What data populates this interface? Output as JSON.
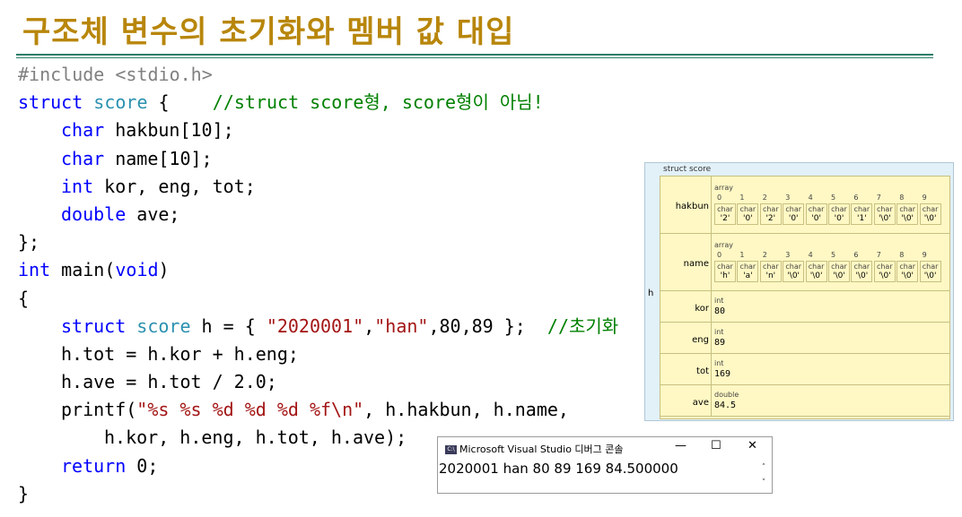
{
  "title": "구조체 변수의 초기화와 멤버 값 대입",
  "code": {
    "include": "#include <stdio.h>",
    "l2_struct": "struct",
    "l2_score": "score",
    "l2_brace": " {",
    "l2_comment": "//struct score형, score형이 아님!",
    "l3_type": "char",
    "l3_rest": " hakbun[10];",
    "l4_type": "char",
    "l4_rest": " name[10];",
    "l5_type": "int",
    "l5_rest": " kor, eng, tot;",
    "l6_type": "double",
    "l6_rest": " ave;",
    "l7": "};",
    "l8_int": "int",
    "l8_main": " main(",
    "l8_void": "void",
    "l8_close": ")",
    "l9": "{",
    "l10_struct": "struct",
    "l10_score": "score",
    "l10_mid": " h = { ",
    "l10_str1": "\"2020001\"",
    "l10_comma": ",",
    "l10_str2": "\"han\"",
    "l10_tail": ",80,89 };",
    "l10_comment": "//초기화",
    "l11": "h.tot = h.kor + h.eng;",
    "l12": "h.ave = h.tot / 2.0;",
    "l13_fn": "printf(",
    "l13_fmt": "\"%s %s %d %d %d %f\\n\"",
    "l13_rest": ", h.hakbun, h.name,",
    "l14": "h.kor, h.eng, h.tot, h.ave);",
    "l15_kw": "return",
    "l15_rest": " 0;",
    "l16": "}"
  },
  "debug_panel": {
    "label": "struct score",
    "var_name": "h",
    "fields": [
      {
        "name": "hakbun",
        "kind": "array",
        "elem_type": "char",
        "indices": [
          "0",
          "1",
          "2",
          "3",
          "4",
          "5",
          "6",
          "7",
          "8",
          "9"
        ],
        "values": [
          "'2'",
          "'0'",
          "'2'",
          "'0'",
          "'0'",
          "'0'",
          "'1'",
          "'\\0'",
          "'\\0'",
          "'\\0'"
        ]
      },
      {
        "name": "name",
        "kind": "array",
        "elem_type": "char",
        "indices": [
          "0",
          "1",
          "2",
          "3",
          "4",
          "5",
          "6",
          "7",
          "8",
          "9"
        ],
        "values": [
          "'h'",
          "'a'",
          "'n'",
          "'\\0'",
          "'\\0'",
          "'\\0'",
          "'\\0'",
          "'\\0'",
          "'\\0'",
          "'\\0'"
        ]
      },
      {
        "name": "kor",
        "type": "int",
        "value": "80"
      },
      {
        "name": "eng",
        "type": "int",
        "value": "89"
      },
      {
        "name": "tot",
        "type": "int",
        "value": "169"
      },
      {
        "name": "ave",
        "type": "double",
        "value": "84.5"
      }
    ]
  },
  "console": {
    "icon_text": "C:\\",
    "title": "Microsoft Visual Studio 디버그 콘솔",
    "minimize": "—",
    "maximize": "☐",
    "close": "✕",
    "output": "2020001 han 80 89 169 84.500000",
    "scroll_up": "˄",
    "scroll_down": "˅"
  }
}
